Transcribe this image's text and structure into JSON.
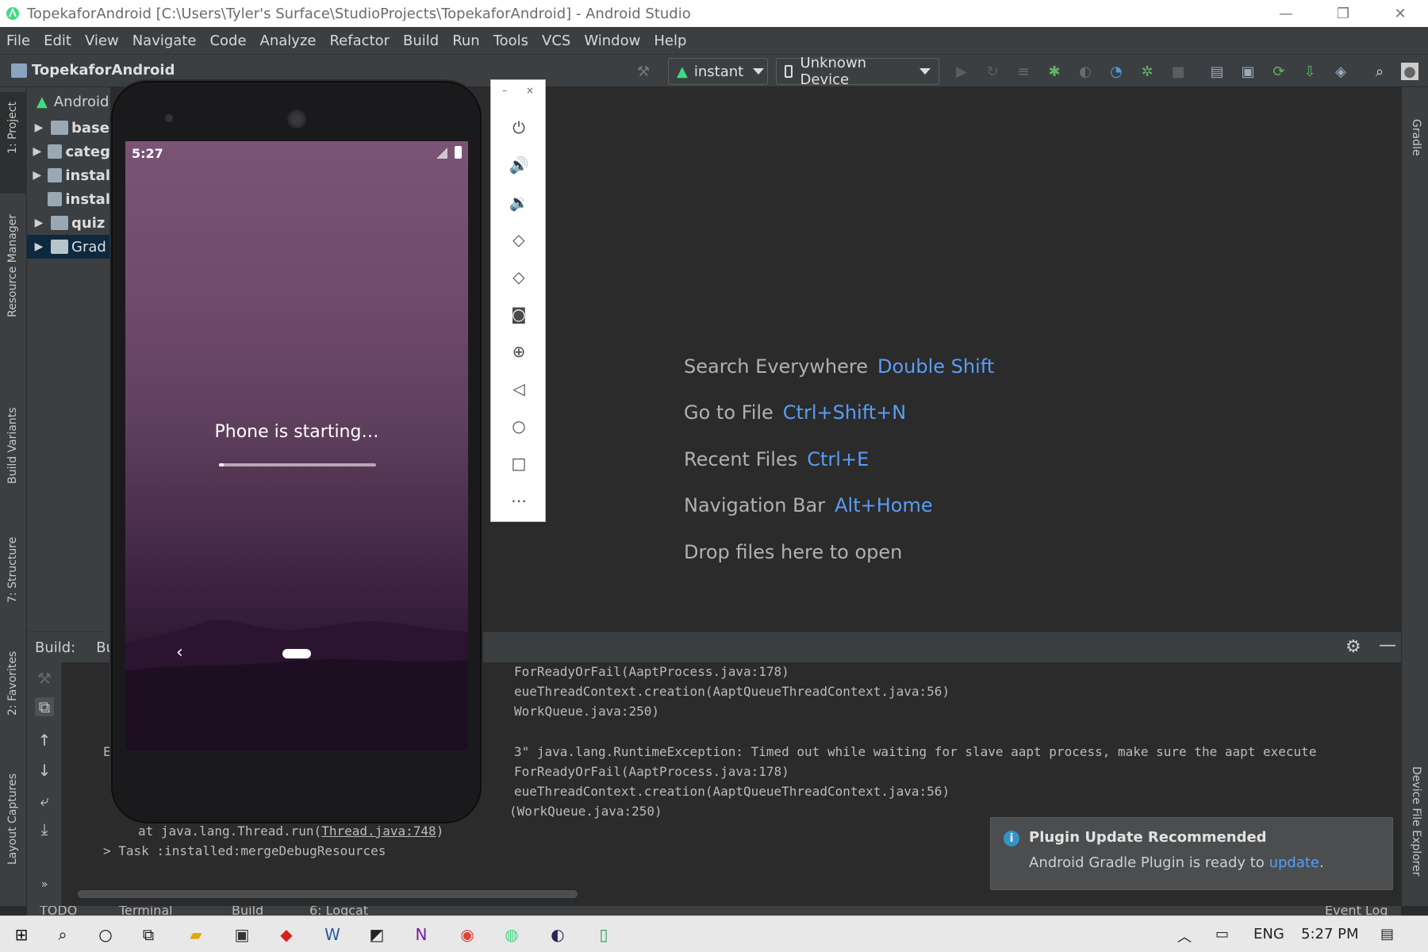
{
  "window": {
    "title": "TopekaforAndroid [C:\\Users\\Tyler's Surface\\StudioProjects\\TopekaforAndroid] - Android Studio",
    "controls": {
      "minimize": "—",
      "restore": "❐",
      "close": "✕"
    }
  },
  "menu": [
    "File",
    "Edit",
    "View",
    "Navigate",
    "Code",
    "Analyze",
    "Refactor",
    "Build",
    "Run",
    "Tools",
    "VCS",
    "Window",
    "Help"
  ],
  "toolbar": {
    "project_name": "TopekaforAndroid",
    "config": "instant",
    "device": "Unknown Device"
  },
  "left_tabs": [
    "1: Project",
    "Resource Manager",
    "Build Variants",
    "7: Structure",
    "2: Favorites",
    "Layout Captures"
  ],
  "right_tabs": [
    "Gradle",
    "Device File Explorer"
  ],
  "project_panel": {
    "header": "Android",
    "items": [
      {
        "label": "base"
      },
      {
        "label": "categ"
      },
      {
        "label": "instal"
      },
      {
        "label": "instal"
      },
      {
        "label": "quiz"
      },
      {
        "label": "Grad"
      }
    ]
  },
  "editor_hints": [
    {
      "label": "Search Everywhere",
      "key": "Double Shift"
    },
    {
      "label": "Go to File",
      "key": "Ctrl+Shift+N"
    },
    {
      "label": "Recent Files",
      "key": "Ctrl+E"
    },
    {
      "label": "Navigation Bar",
      "key": "Alt+Home"
    },
    {
      "label": "Drop files here to open",
      "key": ""
    }
  ],
  "build": {
    "label": "Build:",
    "tab": "Bu",
    "lines": [
      "ForReadyOrFail(AaptProcess.java:178)",
      "eueThreadContext.creation(AaptQueueThreadContext.java:56)",
      "WorkQueue.java:250)",
      "3\" java.lang.RuntimeException: Timed out while waiting for slave aapt process, make sure the aapt execute",
      "ForReadyOrFail(AaptProcess.java:178)",
      "eueThreadContext.creation(AaptQueueThreadContext.java:56)",
      "(WorkQueue.java:250)"
    ],
    "exce": "Exce",
    "at_line_prefix": "at java.lang.Thread.run(",
    "at_line_link": "Thread.java:748",
    "at_line_suffix": ")",
    "task_line": "> Task :installed:mergeDebugResources"
  },
  "bottom_tabs": [
    "TODO",
    "Terminal",
    "Build",
    "6: Logcat",
    "Event Log"
  ],
  "notification": {
    "title": "Plugin Update Recommended",
    "body": "Android Gradle Plugin is ready to",
    "link": "update",
    "suffix": "."
  },
  "emulator": {
    "time": "5:27",
    "message": "Phone is starting…",
    "progress": 0.03
  },
  "emulator_controls": {
    "minimize": "–",
    "close": "×"
  },
  "taskbar": {
    "lang": "ENG",
    "time": "5:27 PM"
  },
  "colors": {
    "accent": "#589df6",
    "android": "#3ddc84",
    "bg": "#2b2b2b",
    "panel": "#3c3f41"
  }
}
